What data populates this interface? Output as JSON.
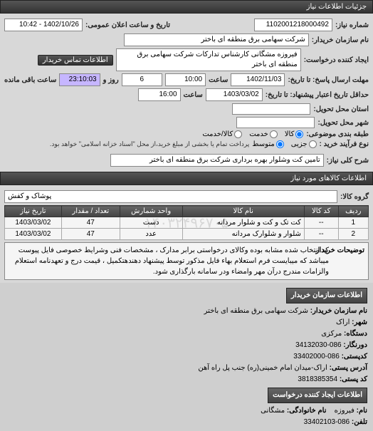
{
  "header": {
    "title": "جزئیات اطلاعات نیاز"
  },
  "top": {
    "lbl_need_no": "شماره نیاز:",
    "need_no": "1102001218000492",
    "lbl_pub_datetime": "تاریخ و ساعت اعلان عمومی:",
    "pub_datetime": "1402/10/26 - 10:42",
    "lbl_buyer_name": "نام سازمان خریدار:",
    "buyer_name": "شرکت سهامی برق منطقه ای باختر",
    "lbl_requester": "ایجاد کننده درخواست:",
    "requester": "فیروزه مشگانی کارشناس تدارکات شرکت سهامی برق منطقه ای باختر",
    "btn_contact": "اطلاعات تماس خریدار",
    "lbl_deadline": "مهلت ارسال پاسخ: تا تاریخ:",
    "deadline_date": "1402/11/03",
    "lbl_hour": "ساعت",
    "deadline_time": "10:00",
    "lbl_days": "روز و",
    "days_left": "6",
    "time_left": "23:10:03",
    "lbl_remaining": "ساعت باقی مانده",
    "lbl_validity": "حداقل تاریخ اعتبار پیشنهاد: تا تاریخ:",
    "validity_date": "1403/03/02",
    "validity_time": "16:00",
    "lbl_delivery_province": "استان محل تحویل:",
    "lbl_delivery_city": "شهر محل تحویل:",
    "lbl_category": "طبقه بندی موضوعی:",
    "cat_goods": "کالا",
    "cat_service": "خدمت",
    "cat_goods_service": "کالا/خدمت",
    "lbl_process": "نوع فرآیند خرید :",
    "proc_minor": "جزیی",
    "proc_medium": "متوسط",
    "proc_note": "پرداخت تمام یا بخشی از مبلغ خرید،از محل \"اسناد خزانه اسلامی\" خواهد بود."
  },
  "summary": {
    "lbl": "شرح کلی نیاز:",
    "text": "تامین کت وشلوار بهره برداری شرکت برق منطقه ای باختر"
  },
  "items": {
    "title": "اطلاعات کالاهای مورد نیاز",
    "lbl_group": "گروه کالا:",
    "group": "پوشاک و کفش",
    "cols": {
      "row": "ردیف",
      "code": "کد کالا",
      "name": "نام کالا",
      "unit": "واحد شمارش",
      "qty": "تعداد / مقدار",
      "date": "تاریخ نیاز"
    },
    "rows": [
      {
        "row": "1",
        "code": "--",
        "name": "کت تک و کت و شلوار مردانه",
        "unit": "دست",
        "qty": "47",
        "date": "1403/03/02"
      },
      {
        "row": "2",
        "code": "--",
        "name": "شلوار و شلوارک مردانه",
        "unit": "عدد",
        "qty": "47",
        "date": "1403/03/02"
      }
    ],
    "watermark": "۱۴۰۳۲۴۹۶۷۰۵",
    "desc_lbl": "توضیحات خریدار",
    "desc": "کد انتخاب شده مشابه بوده وکالای درخواستی برابر مدارک ، مشخصات فنی وشرایط خصوصی فایل پیوست میباشد که میبایست فرم استعلام بهاء فایل مذکور توسط پیشنهاد دهندهتکمیل ، قیمت درج و تعهدنامه استعلام والزامات مندرج درآن مهر وامضاء ودر سامانه بارگذاری شود."
  },
  "buyer": {
    "hdr1": "اطلاعات سازمان خریدار",
    "l_name": "نام سازمان خریدار:",
    "v_name": "شرکت سهامی برق منطقه ای باختر",
    "l_city": "شهر:",
    "v_city": "اراک",
    "l_org": "دستگاه:",
    "v_org": "مرکزی",
    "l_phone": "دورنگار:",
    "v_phone": "086-34132030",
    "l_acct": "کدپستی:",
    "v_acct": "086-33402000",
    "l_addr": "آدرس پستی:",
    "v_addr": "اراک-میدان امام خمینی(ره) جنب پل راه آهن",
    "l_post": "کد پستی:",
    "v_post": "3818385354",
    "hdr2": "اطلاعات ایجاد کننده درخواست",
    "l_first": "نام:",
    "v_first": "فیروزه",
    "l_last": "نام خانوادگی:",
    "v_last": "مشگانی",
    "l_tel": "تلفن:",
    "v_tel": "086-33402103"
  }
}
